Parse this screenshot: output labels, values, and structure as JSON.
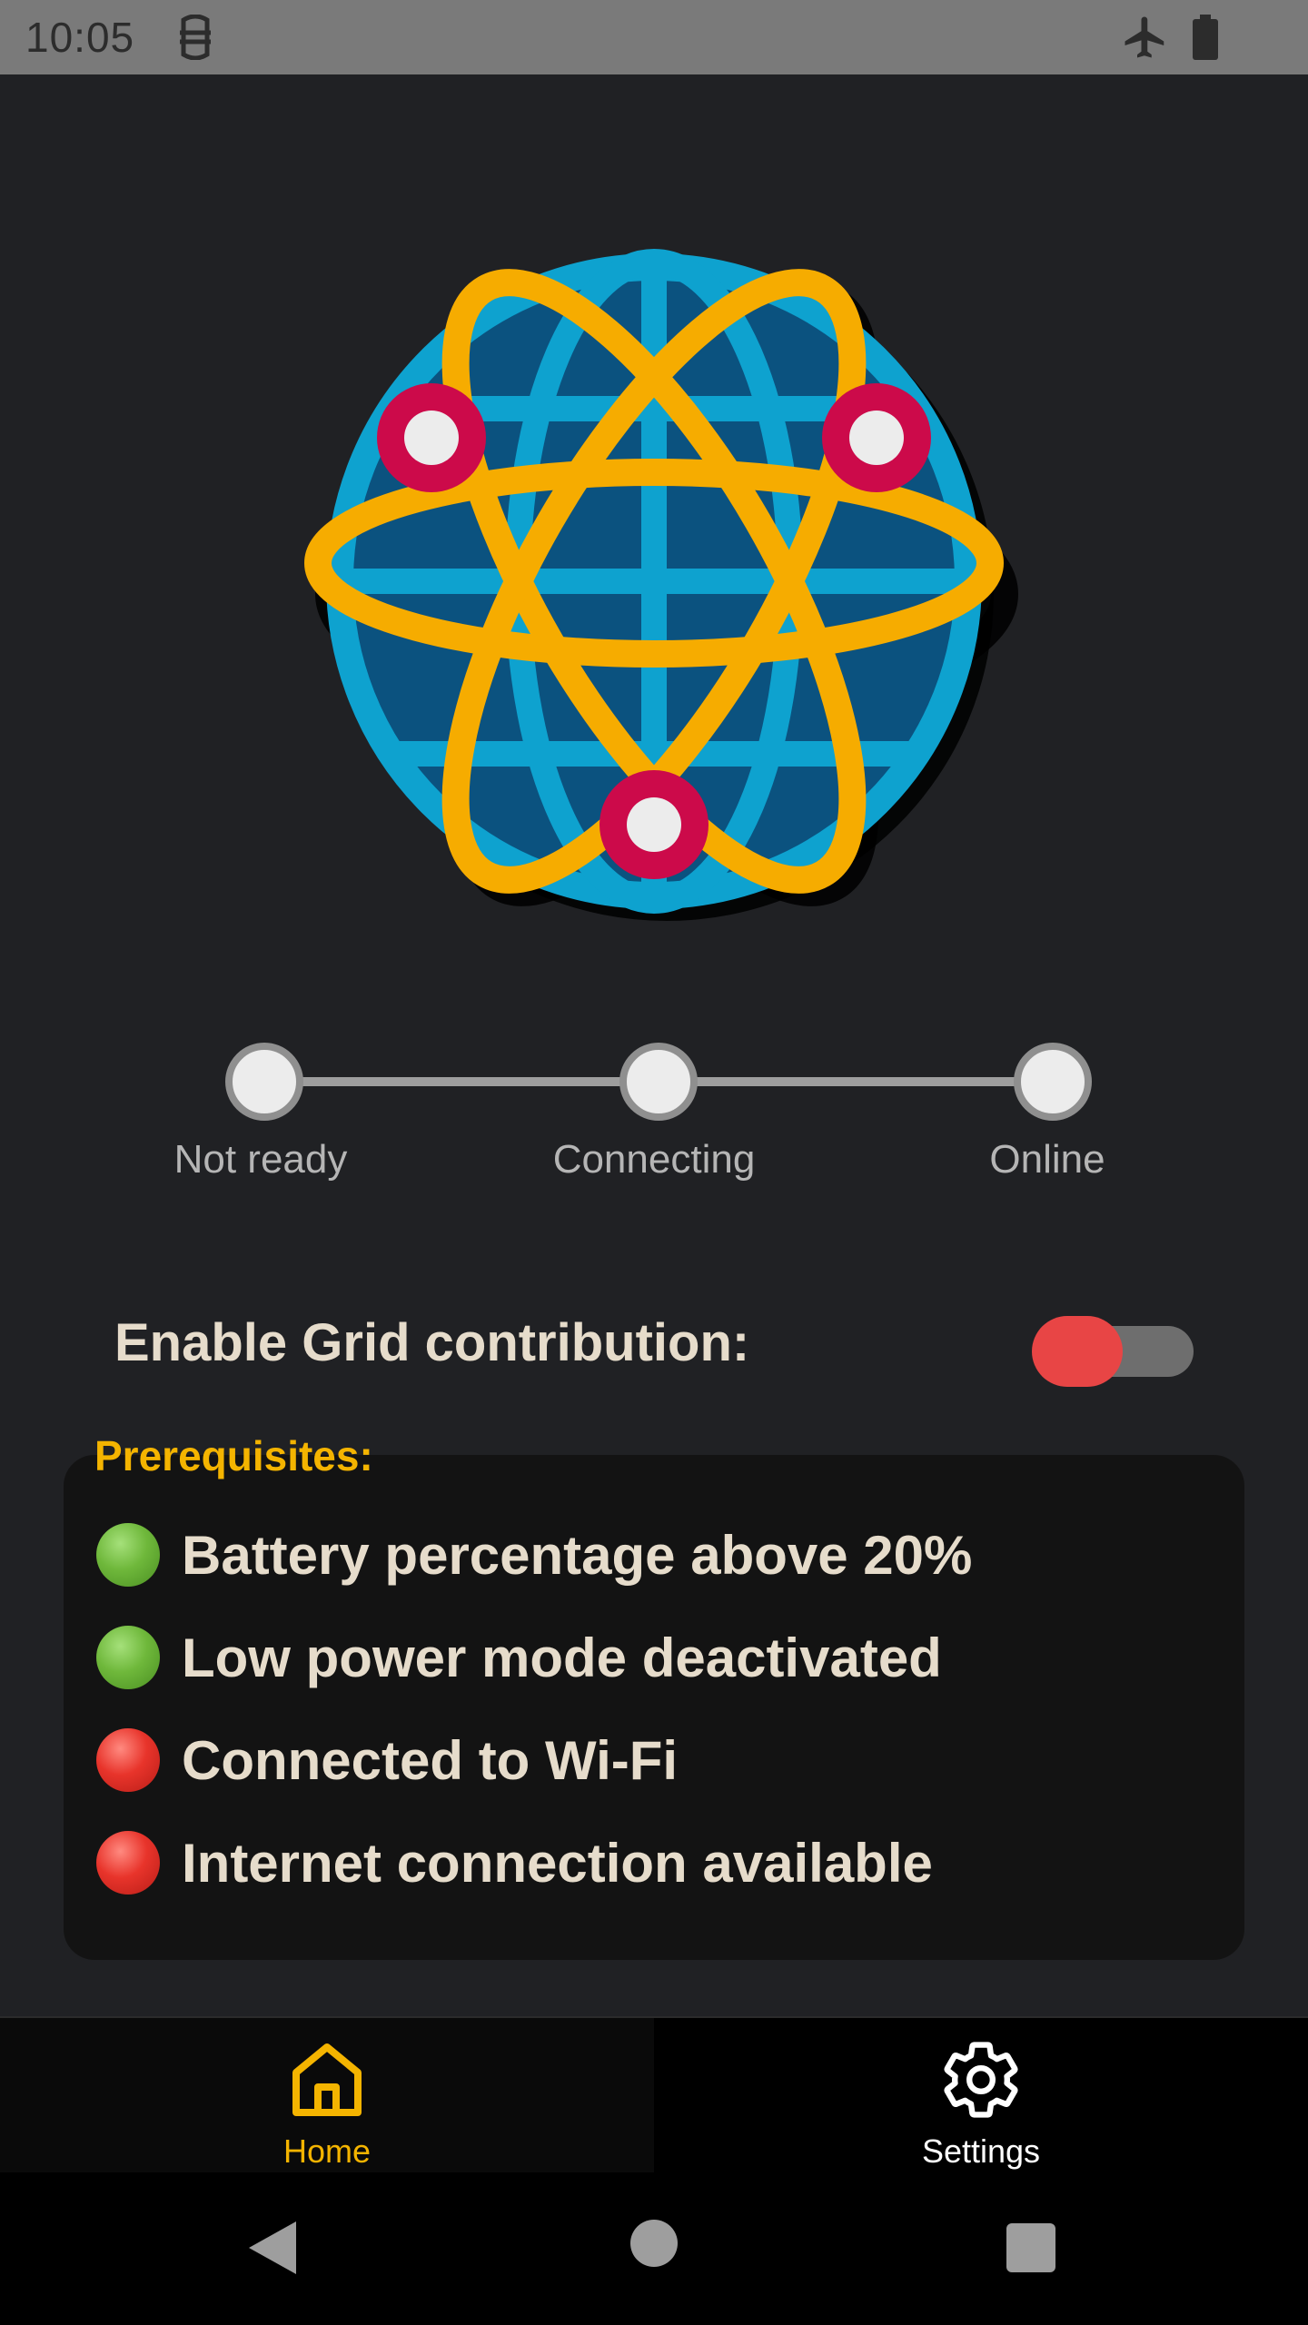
{
  "status_bar": {
    "time": "10:05",
    "icons": [
      "app-notification-icon",
      "airplane-mode-icon",
      "battery-icon"
    ]
  },
  "hero": {
    "icon": "network-globe-icon"
  },
  "stepper": {
    "steps": [
      {
        "label": "Not ready"
      },
      {
        "label": "Connecting"
      },
      {
        "label": "Online"
      }
    ]
  },
  "grid_toggle": {
    "label": "Enable Grid contribution:",
    "enabled": false,
    "thumb_color": "#e84545"
  },
  "prerequisites": {
    "title": "Prerequisites:",
    "items": [
      {
        "label": "Battery percentage above 20%",
        "status": "ok"
      },
      {
        "label": "Low power mode deactivated",
        "status": "ok"
      },
      {
        "label": "Connected to Wi-Fi",
        "status": "fail"
      },
      {
        "label": "Internet connection available",
        "status": "fail"
      }
    ]
  },
  "bottom_nav": {
    "items": [
      {
        "label": "Home",
        "icon": "home-icon",
        "active": true,
        "color": "#f4b400"
      },
      {
        "label": "Settings",
        "icon": "gear-icon",
        "active": false,
        "color": "#ffffff"
      }
    ]
  },
  "system_nav": {
    "icons": [
      "back-icon",
      "home-circle-icon",
      "recents-icon"
    ]
  }
}
